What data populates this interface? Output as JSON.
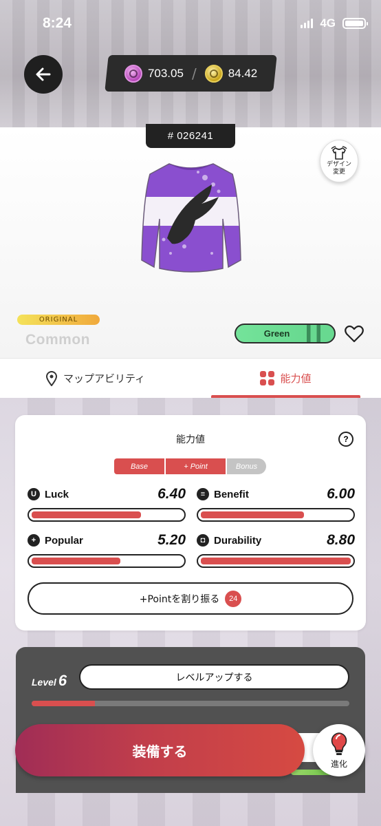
{
  "status": {
    "time": "8:24",
    "network": "4G"
  },
  "currency": {
    "gem_value": "703.05",
    "coin_value": "84.42"
  },
  "item": {
    "id": "# 026241",
    "design_change_label": "デザイン\n変更",
    "badge": "ORIGINAL",
    "rarity": "Common",
    "color_chip": "Green"
  },
  "tabs": [
    {
      "label": "マップアビリティ",
      "active": false
    },
    {
      "label": "能力値",
      "active": true
    }
  ],
  "stats_card": {
    "title": "能力値",
    "help": "?",
    "segments": [
      "Base",
      "+ Point",
      "Bonus"
    ],
    "stats": [
      {
        "name": "Luck",
        "value": "6.40",
        "fill": 0.73,
        "icon": "U"
      },
      {
        "name": "Benefit",
        "value": "6.00",
        "fill": 0.69,
        "icon": "≡"
      },
      {
        "name": "Popular",
        "value": "5.20",
        "fill": 0.59,
        "icon": "+"
      },
      {
        "name": "Durability",
        "value": "8.80",
        "fill": 1.0,
        "icon": "◘"
      }
    ],
    "assign_label": "+Pointを割り振る",
    "assign_count": "24"
  },
  "level": {
    "label": "Level",
    "value": "6",
    "button": "レベルアップする",
    "progress": 0.2
  },
  "actions": {
    "equip": "装備する",
    "evolve": "進化"
  },
  "colors": {
    "accent": "#d94f4f",
    "dark": "#222222",
    "panel": "#515151",
    "green": "#6fdd95"
  }
}
